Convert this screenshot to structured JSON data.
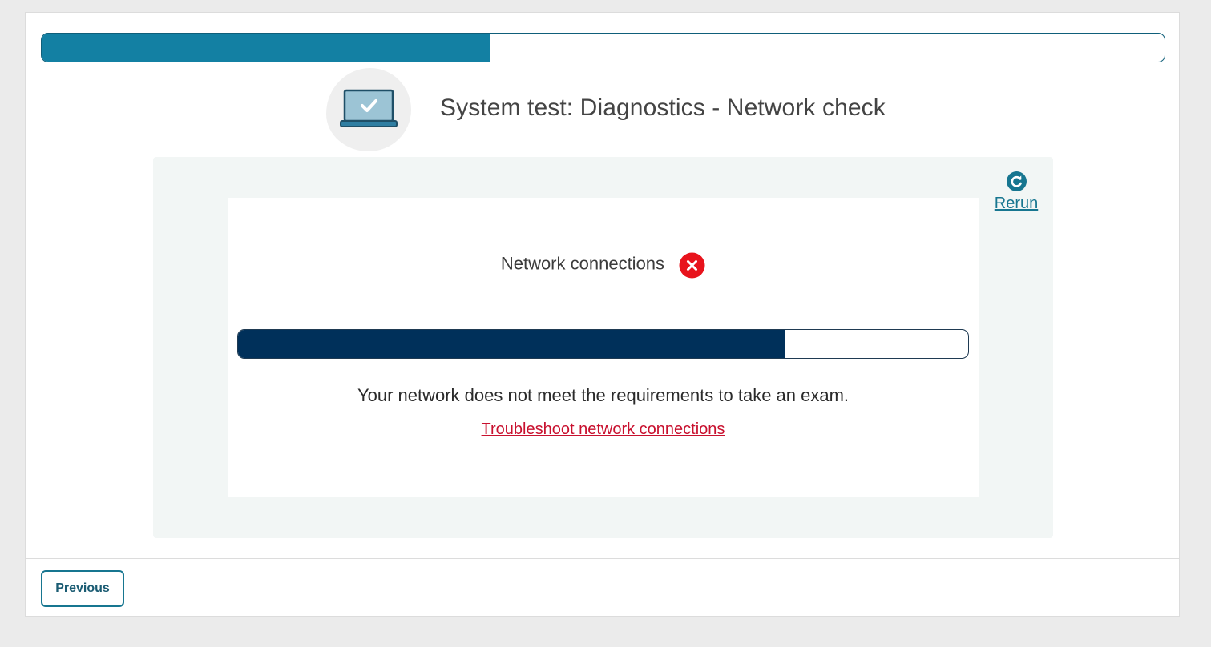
{
  "overall_progress": {
    "value": 0.4
  },
  "header": {
    "icon": "laptop-check-icon",
    "title": "System test: Diagnostics - Network check"
  },
  "panel": {
    "rerun": {
      "icon": "refresh-icon",
      "label": "Rerun"
    },
    "check": {
      "label": "Network connections",
      "status_icon": "error-x-icon",
      "progress": 0.75
    },
    "message": "Your network does not meet the requirements to take an exam.",
    "troubleshoot_link": "Troubleshoot network connections"
  },
  "footer": {
    "previous_label": "Previous"
  },
  "colors": {
    "accent": "#1380a3",
    "check_progress": "#00305a",
    "error": "#e8131c",
    "link_error": "#c8102e"
  }
}
